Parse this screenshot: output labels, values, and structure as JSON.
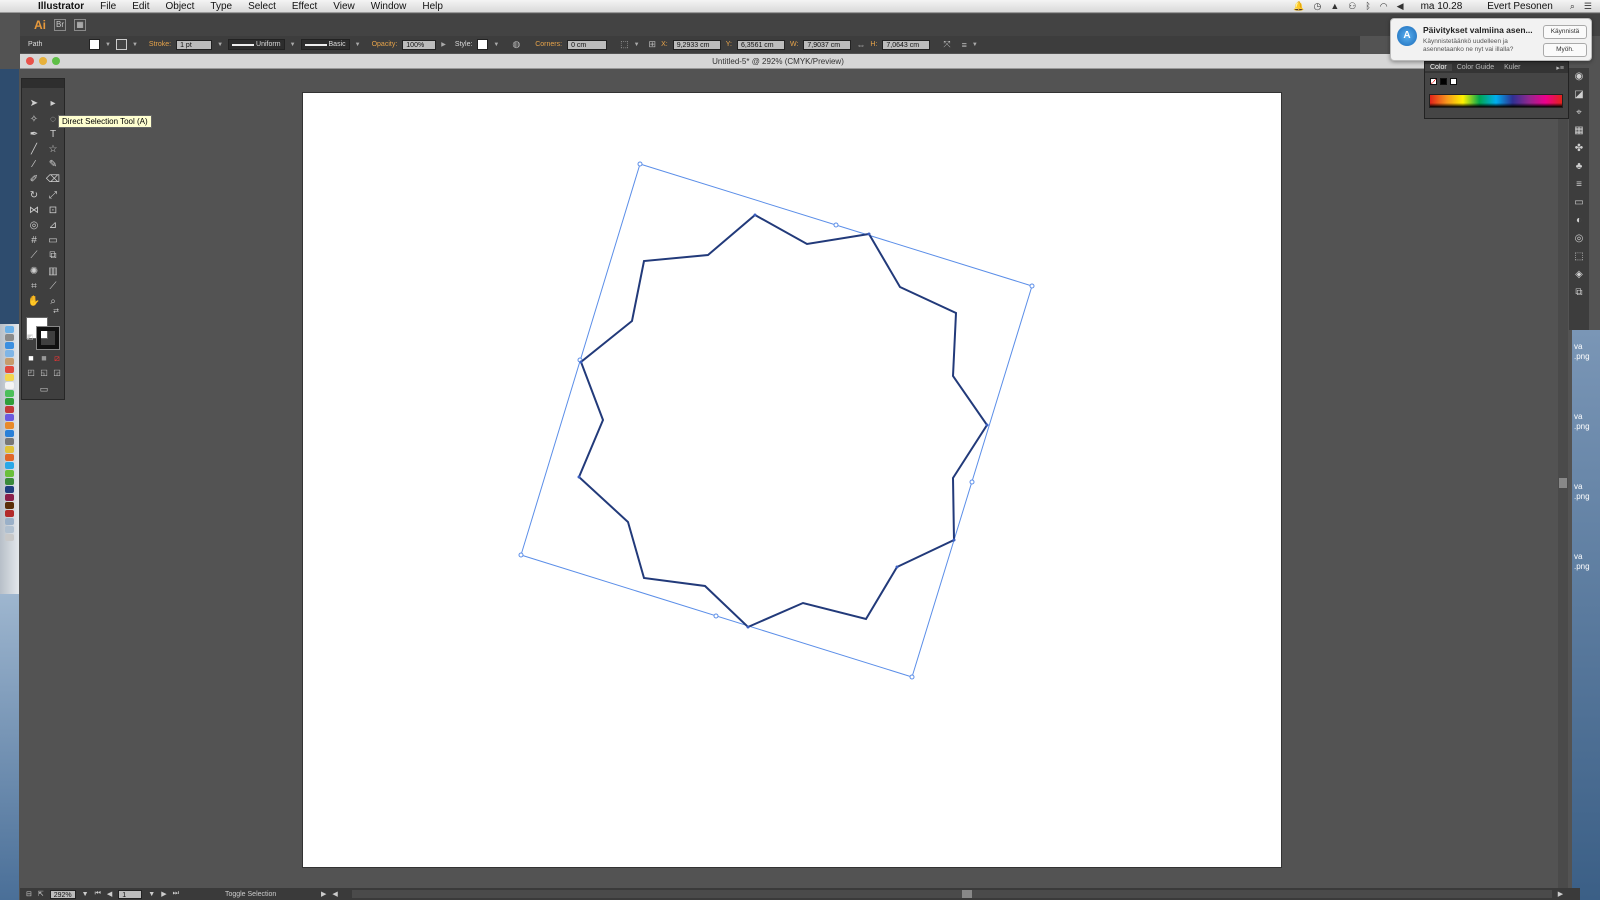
{
  "menubar": {
    "app_name": "Illustrator",
    "menus": [
      "File",
      "Edit",
      "Object",
      "Type",
      "Select",
      "Effect",
      "View",
      "Window",
      "Help"
    ],
    "clock": "ma 10.28",
    "user": "Evert Pesonen"
  },
  "appbar": {
    "logo": "Ai",
    "bridge_label": "Br"
  },
  "controlbar": {
    "selection_label": "Path",
    "stroke_label": "Stroke:",
    "stroke_weight": "1 pt",
    "profile_label": "Uniform",
    "brush_label": "Basic",
    "opacity_label": "Opacity:",
    "opacity_value": "100%",
    "style_label": "Style:",
    "corners_label": "Corners:",
    "corners_value": "0 cm",
    "x_label": "X:",
    "x_value": "9,2933 cm",
    "y_label": "Y:",
    "y_value": "6,3561 cm",
    "w_label": "W:",
    "w_value": "7,9037 cm",
    "h_label": "H:",
    "h_value": "7,0643 cm"
  },
  "document": {
    "title": "Untitled-5* @ 292% (CMYK/Preview)"
  },
  "tools": {
    "tooltip": "Direct Selection Tool (A)"
  },
  "color_panel": {
    "tabs": [
      "Color",
      "Color Guide",
      "Kuler"
    ]
  },
  "notification": {
    "title": "Päivitykset valmiina asen...",
    "body": "Käynnistetäänkö uudelleen ja asennetaanko ne nyt vai illalla?",
    "primary_button": "Käynnistä",
    "secondary_button": "Myöh."
  },
  "statusbar": {
    "zoom": "292%",
    "artboard_number": "1",
    "status_text": "Toggle Selection"
  },
  "desktop": {
    "file_labels": [
      "va",
      ".png",
      "va",
      ".png",
      "va",
      ".png",
      "va",
      ".png"
    ]
  },
  "colors": {
    "path_stroke": "#223a7a",
    "bounding_box": "#5b8ee8",
    "app_accent": "#e89a3c"
  }
}
